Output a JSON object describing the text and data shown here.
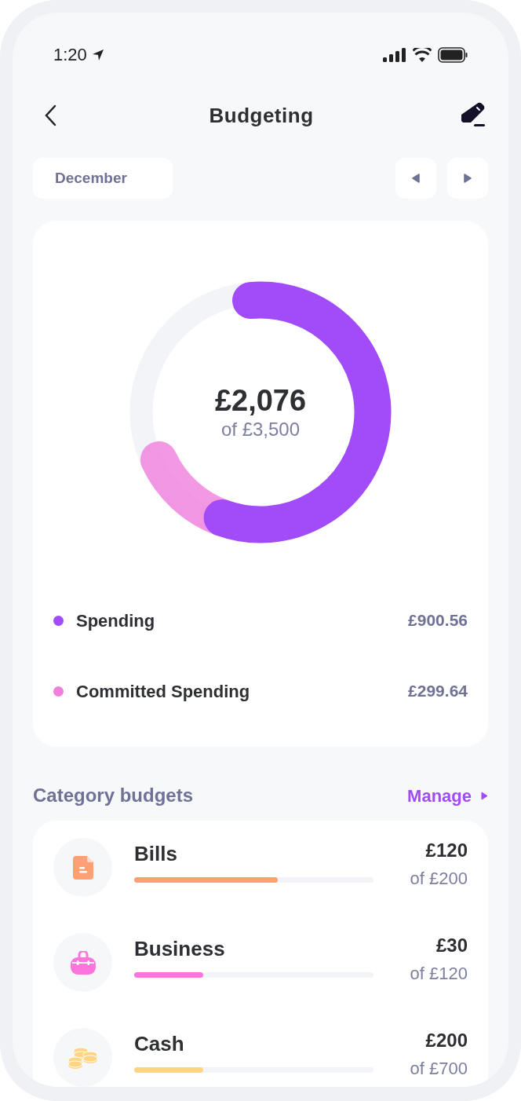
{
  "status_bar": {
    "time": "1:20"
  },
  "header": {
    "title": "Budgeting"
  },
  "period": {
    "month": "December"
  },
  "summary": {
    "amount": "£2,076",
    "total": "of £3,500",
    "legend": [
      {
        "label": "Spending",
        "value": "£900.56",
        "color": "#a24bf8"
      },
      {
        "label": "Committed Spending",
        "value": "£299.64",
        "color": "#f07edc"
      }
    ]
  },
  "categories": {
    "title": "Category budgets",
    "manage": "Manage",
    "items": [
      {
        "name": "Bills",
        "kind": "bills",
        "spent": "£120",
        "budget": "of £200",
        "level": 0.6,
        "color": "#ff9f74"
      },
      {
        "name": "Business",
        "kind": "business",
        "spent": "£30",
        "budget": "of £120",
        "level": 0.29,
        "color": "#fb76dc"
      },
      {
        "name": "Cash",
        "kind": "cash",
        "spent": "£200",
        "budget": "of £700",
        "level": 0.29,
        "color": "#ffd584"
      }
    ]
  }
}
